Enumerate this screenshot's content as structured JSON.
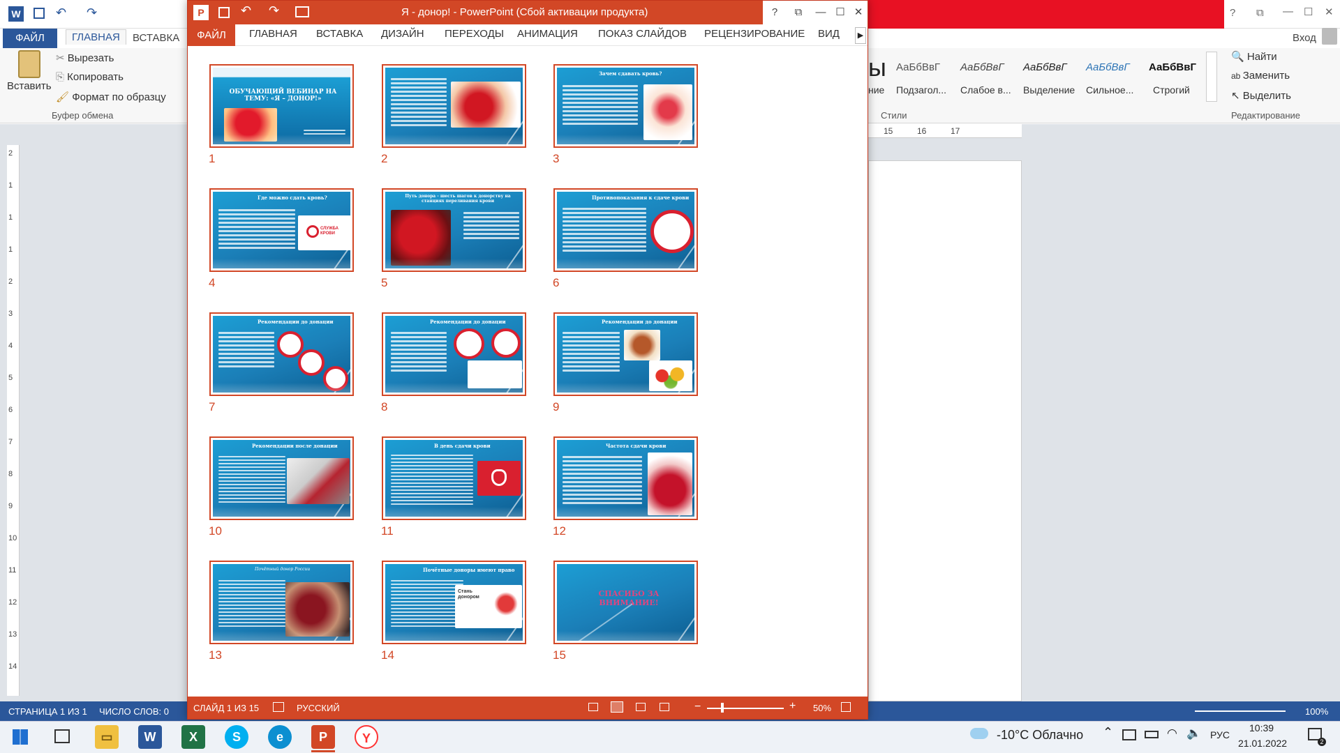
{
  "word": {
    "tabs": [
      "ФАЙЛ",
      "ГЛАВНАЯ",
      "ВСТАВКА"
    ],
    "login": "Вход",
    "clipboard": {
      "paste": "Вставить",
      "cut": "Вырезать",
      "copy": "Копировать",
      "format": "Формат по образцу",
      "group": "Буфер обмена"
    },
    "styles": {
      "sample": "АаБбВвГ",
      "items": [
        "Подзагол...",
        "Слабое в...",
        "Выделение",
        "Сильное...",
        "Строгий"
      ],
      "group": "Стили",
      "partial": "ние"
    },
    "editing": {
      "find": "Найти",
      "replace": "Заменить",
      "select": "Выделить",
      "group": "Редактирование"
    },
    "ruler": [
      "15",
      "16",
      "17"
    ],
    "vruler": [
      "2",
      "1",
      "1",
      "1",
      "2",
      "3",
      "4",
      "5",
      "6",
      "7",
      "8",
      "9",
      "10",
      "11",
      "12",
      "13",
      "14"
    ],
    "status": {
      "page": "СТРАНИЦА 1 ИЗ 1",
      "words": "ЧИСЛО СЛОВ: 0",
      "zoom": "100%"
    }
  },
  "ppt": {
    "title": "Я - донор! - PowerPoint (Сбой активации продукта)",
    "tabs": [
      "ФАЙЛ",
      "ГЛАВНАЯ",
      "ВСТАВКА",
      "ДИЗАЙН",
      "ПЕРЕХОДЫ",
      "АНИМАЦИЯ",
      "ПОКАЗ СЛАЙДОВ",
      "РЕЦЕНЗИРОВАНИЕ",
      "ВИД"
    ],
    "status": {
      "slide": "СЛАЙД 1 ИЗ 15",
      "lang": "РУССКИЙ",
      "zoom": "50%"
    },
    "slides": [
      {
        "n": "1",
        "title": "ОБУЧАЮЩИЙ ВЕБИНАР НА ТЕМУ: «Я – ДОНОР!»"
      },
      {
        "n": "2"
      },
      {
        "n": "3",
        "title": "Зачем сдавать кровь?"
      },
      {
        "n": "4",
        "title": "Где можно сдать кровь?",
        "logo": "СЛУЖБА КРОВИ"
      },
      {
        "n": "5",
        "title": "Путь донора - шесть шагов к донорству на станциях переливания крови"
      },
      {
        "n": "6",
        "title": "Противопоказания к сдаче крови"
      },
      {
        "n": "7",
        "title": "Рекомендации до донации"
      },
      {
        "n": "8",
        "title": "Рекомендации до донации"
      },
      {
        "n": "9",
        "title": "Рекомендации до донации"
      },
      {
        "n": "10",
        "title": "Рекомендации после донации"
      },
      {
        "n": "11",
        "title": "В день сдачи крови"
      },
      {
        "n": "12",
        "title": "Частота сдачи крови"
      },
      {
        "n": "13",
        "title": "Почётный донор России"
      },
      {
        "n": "14",
        "title": "Почётные доноры имеют право",
        "banner": "Стань донором"
      },
      {
        "n": "15",
        "title": "СПАСИБО ЗА ВНИМАНИЕ!"
      }
    ]
  },
  "taskbar": {
    "weather": "-10°C Облачно",
    "lang": "РУС",
    "time": "10:39",
    "date": "21.01.2022"
  }
}
